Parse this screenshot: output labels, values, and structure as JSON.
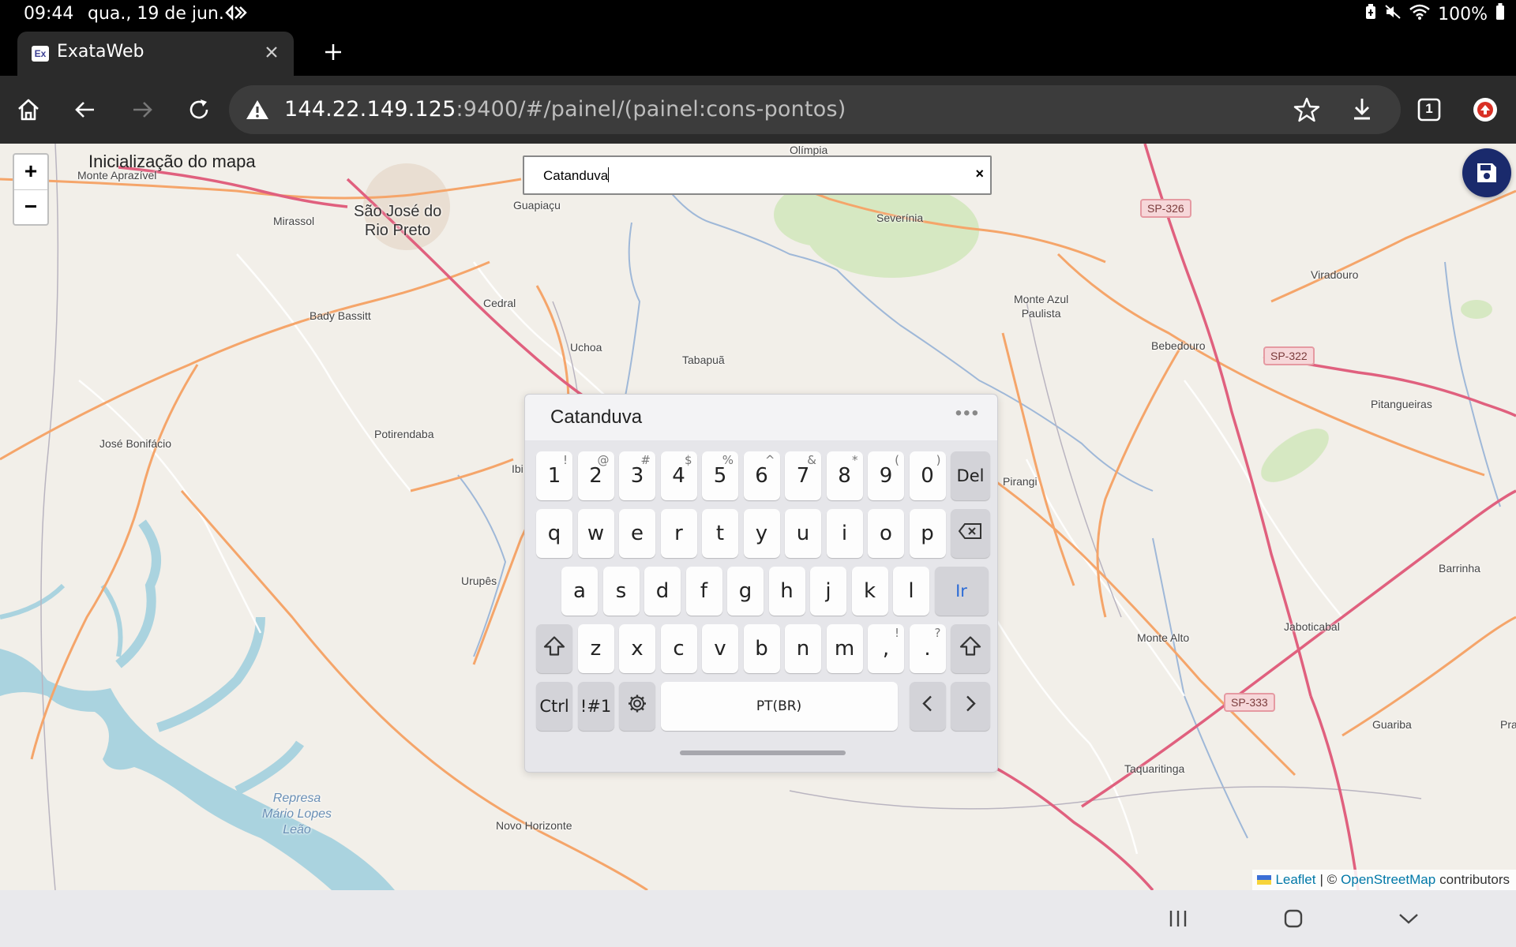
{
  "status": {
    "time": "09:44",
    "date": "qua., 19 de jun.",
    "battery_text": "100%"
  },
  "browser": {
    "tab_title": "ExataWeb",
    "favicon_text": "Ex",
    "url_host": "144.22.149.125",
    "url_path": ":9400/#/painel/(painel:cons-pontos)",
    "tab_count": "1"
  },
  "map": {
    "zoom_in": "+",
    "zoom_out": "−",
    "init_label": "Inicialização do mapa",
    "search_value": "Catanduva",
    "search_clear": "×",
    "places": {
      "monte_aprazivel": "Monte Aprazível",
      "olimpia": "Olímpia",
      "sao_jose_l1": "São José do",
      "sao_jose_l2": "Rio Preto",
      "mirassol": "Mirassol",
      "guapiacu": "Guapiaçu",
      "severinia": "Severínia",
      "cedral": "Cedral",
      "bady_bassitt": "Bady Bassitt",
      "uchoa": "Uchoa",
      "tabapua": "Tabapuã",
      "monte_azul_l1": "Monte Azul",
      "monte_azul_l2": "Paulista",
      "viradouro": "Viradouro",
      "bebedouro": "Bebedouro",
      "pitangueiras": "Pitangueiras",
      "potirendaba": "Potirendaba",
      "jose_bonifacio": "José Bonifácio",
      "ibi": "Ibi",
      "pirangi": "Pirangi",
      "urupes": "Urupês",
      "barrinha": "Barrinha",
      "monte_alto": "Monte Alto",
      "jaboticabal": "Jaboticabal",
      "guariba": "Guariba",
      "pra": "Pra",
      "taquaritinga": "Taquaritinga",
      "novo_horizonte": "Novo Horizonte",
      "represa_l1": "Represa",
      "represa_l2": "Mário Lopes",
      "represa_l3": "Leão"
    },
    "shields": {
      "sp326": "SP-326",
      "sp322": "SP-322",
      "sp333": "SP-333"
    },
    "attribution": {
      "leaflet": "Leaflet",
      "sep": "| ©",
      "osm": "OpenStreetMap",
      "contrib": "contributors"
    }
  },
  "keyboard": {
    "suggestion": "Catanduva",
    "more": "•••",
    "row_numbers": [
      {
        "k": "1",
        "s": "!"
      },
      {
        "k": "2",
        "s": "@"
      },
      {
        "k": "3",
        "s": "#"
      },
      {
        "k": "4",
        "s": "$"
      },
      {
        "k": "5",
        "s": "%"
      },
      {
        "k": "6",
        "s": "^"
      },
      {
        "k": "7",
        "s": "&"
      },
      {
        "k": "8",
        "s": "*"
      },
      {
        "k": "9",
        "s": "("
      },
      {
        "k": "0",
        "s": ")"
      }
    ],
    "del_label": "Del",
    "row_q": [
      "q",
      "w",
      "e",
      "r",
      "t",
      "y",
      "u",
      "i",
      "o",
      "p"
    ],
    "row_a": [
      "a",
      "s",
      "d",
      "f",
      "g",
      "h",
      "j",
      "k",
      "l"
    ],
    "go_label": "Ir",
    "row_z": [
      "z",
      "x",
      "c",
      "v",
      "b",
      "n",
      "m"
    ],
    "comma": {
      "k": ",",
      "s": "!"
    },
    "period": {
      "k": ".",
      "s": "?"
    },
    "ctrl_label": "Ctrl",
    "sym_label": "!#1",
    "space_label": "PT(BR)"
  },
  "colors": {
    "accent": "#1a2a6c",
    "highway": "#e0607e",
    "road": "#f5a56a",
    "water": "#aad3df",
    "go_key": "#2b6bd6"
  }
}
